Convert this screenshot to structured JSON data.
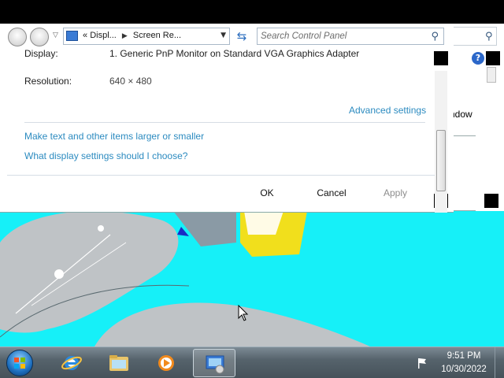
{
  "colors": {
    "link": "#2c8bc0",
    "desktop": "#16f0f8",
    "taskbar": "#56636c",
    "disabled_text": "#8d8d8d"
  },
  "address_bar": {
    "prefix": "«",
    "crumb1": "Displ...",
    "crumb2": "Screen Re..."
  },
  "search": {
    "placeholder": "Search Control Panel"
  },
  "settings": {
    "display_label": "Display:",
    "display_value": "1. Generic PnP Monitor on Standard VGA Graphics Adapter",
    "resolution_label": "Resolution:",
    "resolution_value": "640 × 480",
    "advanced_link": "Advanced settings",
    "link_larger": "Make text and other items larger or smaller",
    "link_choose": "What display settings should I choose?"
  },
  "buttons": {
    "ok": "OK",
    "cancel": "Cancel",
    "apply": "Apply"
  },
  "back_window": {
    "partial_text": "ndow"
  },
  "taskbar": {
    "items": [
      "internet-explorer-icon",
      "windows-explorer-icon",
      "media-player-icon",
      "control-panel-icon"
    ],
    "time": "9:51 PM",
    "date": "10/30/2022"
  }
}
